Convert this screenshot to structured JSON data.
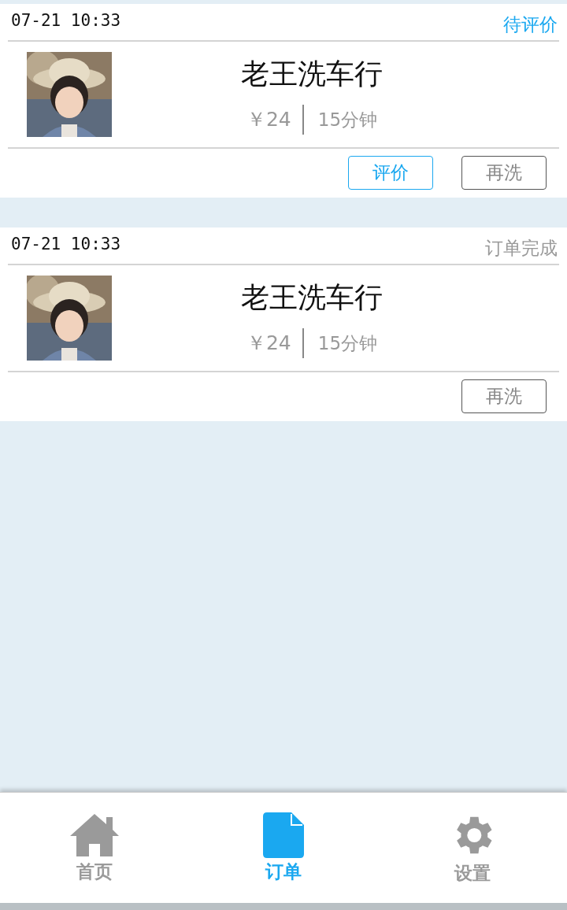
{
  "orders": [
    {
      "time": "07-21 10:33",
      "status": {
        "text": "待评价",
        "kind": "pending"
      },
      "avatar": {
        "kind": "picture"
      },
      "shop": "老王洗车行",
      "price": "￥24",
      "duration": "15分钟",
      "buttons": [
        {
          "label": "评价",
          "kind": "primary"
        },
        {
          "label": "再洗",
          "kind": "normal"
        }
      ]
    },
    {
      "time": "07-21 10:33",
      "status": {
        "text": "订单完成",
        "kind": "done"
      },
      "avatar": {
        "kind": "picture"
      },
      "shop": "老王洗车行",
      "price": "￥24",
      "duration": "15分钟",
      "buttons": [
        {
          "label": "再洗",
          "kind": "normal"
        }
      ]
    }
  ],
  "tabbar": [
    {
      "label": "首页",
      "kind": "home",
      "selected": false
    },
    {
      "label": "订单",
      "kind": "orders",
      "selected": true
    },
    {
      "label": "设置",
      "kind": "settings",
      "selected": false
    }
  ]
}
